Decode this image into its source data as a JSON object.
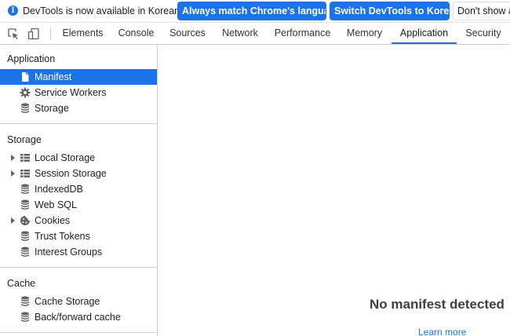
{
  "infobar": {
    "message": "DevTools is now available in Korean!",
    "match_language_button": "Always match Chrome's language",
    "switch_button": "Switch DevTools to Korean",
    "dont_show_button": "Don't show again"
  },
  "tabs": [
    "Elements",
    "Console",
    "Sources",
    "Network",
    "Performance",
    "Memory",
    "Application",
    "Security"
  ],
  "active_tab": "Application",
  "sidebar": {
    "application": {
      "title": "Application",
      "items": [
        "Manifest",
        "Service Workers",
        "Storage"
      ]
    },
    "storage": {
      "title": "Storage",
      "items": [
        "Local Storage",
        "Session Storage",
        "IndexedDB",
        "Web SQL",
        "Cookies",
        "Trust Tokens",
        "Interest Groups"
      ]
    },
    "cache": {
      "title": "Cache",
      "items": [
        "Cache Storage",
        "Back/forward cache"
      ]
    },
    "selected_item": "Manifest"
  },
  "main": {
    "empty_title": "No manifest detected",
    "learn_more": "Learn more"
  },
  "colors": {
    "accent": "#1a73e8",
    "selection": "#1a73e8"
  }
}
